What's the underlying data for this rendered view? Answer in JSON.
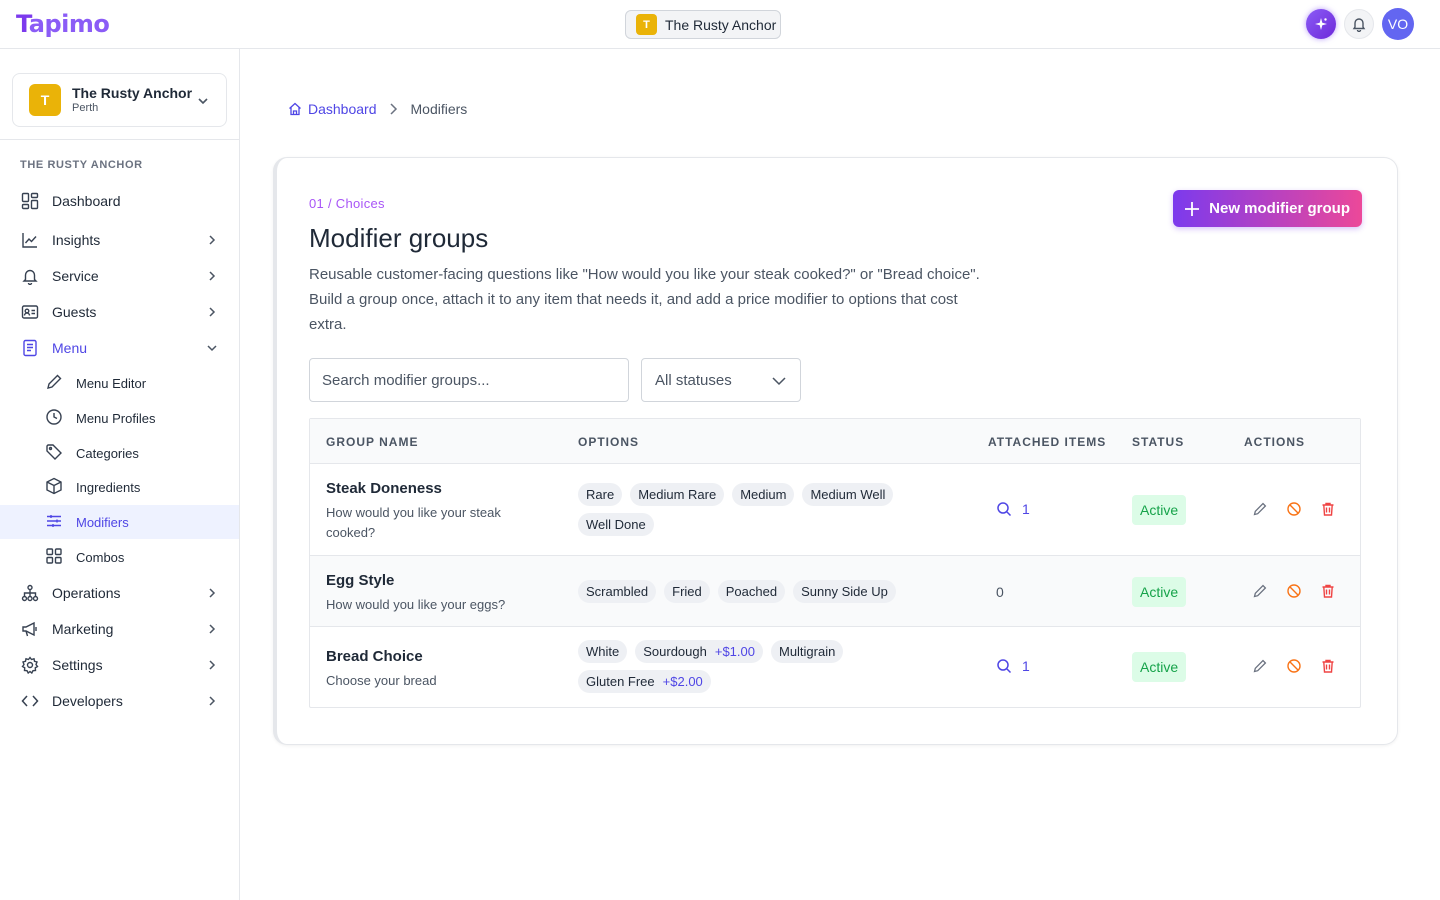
{
  "app": {
    "logo_first": "T",
    "logo_rest": "apimo",
    "venue_pill": {
      "badge": "T",
      "name": "The Rusty Anchor"
    },
    "avatar": "VO",
    "colors": {
      "accent": "#4f46e5",
      "brand": "#8b5cf6",
      "venue_badge": "#eab308",
      "active_green": "#16a34a"
    }
  },
  "sidebar": {
    "venue": {
      "badge": "T",
      "name": "The Rusty Anchor",
      "city": "Perth"
    },
    "section_label": "THE RUSTY ANCHOR",
    "items": [
      {
        "label": "Dashboard",
        "icon": "dashboard-icon"
      },
      {
        "label": "Insights",
        "icon": "chart-icon"
      },
      {
        "label": "Service",
        "icon": "bell-icon"
      },
      {
        "label": "Guests",
        "icon": "id-card-icon"
      },
      {
        "label": "Menu",
        "icon": "menu-book-icon"
      },
      {
        "label": "Operations",
        "icon": "network-icon"
      },
      {
        "label": "Marketing",
        "icon": "megaphone-icon"
      },
      {
        "label": "Settings",
        "icon": "gear-icon"
      },
      {
        "label": "Developers",
        "icon": "code-icon"
      }
    ],
    "menu_sub": [
      {
        "label": "Menu Editor",
        "icon": "pencil-icon"
      },
      {
        "label": "Menu Profiles",
        "icon": "clock-icon"
      },
      {
        "label": "Categories",
        "icon": "tag-icon"
      },
      {
        "label": "Ingredients",
        "icon": "cube-icon"
      },
      {
        "label": "Modifiers",
        "icon": "sliders-icon"
      },
      {
        "label": "Combos",
        "icon": "grid-icon"
      }
    ]
  },
  "breadcrumb": {
    "home": "Dashboard",
    "current": "Modifiers"
  },
  "page": {
    "eyebrow": "01 / Choices",
    "title": "Modifier groups",
    "description": "Reusable customer-facing questions like \"How would you like your steak cooked?\" or \"Bread choice\". Build a group once, attach it to any item that needs it, and add a price modifier to options that cost extra.",
    "new_button": "New modifier group"
  },
  "filters": {
    "search_placeholder": "Search modifier groups...",
    "status_value": "All statuses"
  },
  "table": {
    "headers": [
      "GROUP NAME",
      "OPTIONS",
      "ATTACHED ITEMS",
      "STATUS",
      "ACTIONS"
    ],
    "rows": [
      {
        "name": "Steak Doneness",
        "description": "How would you like your steak cooked?",
        "options": [
          {
            "label": "Rare"
          },
          {
            "label": "Medium Rare"
          },
          {
            "label": "Medium"
          },
          {
            "label": "Medium Well"
          },
          {
            "label": "Well Done"
          }
        ],
        "attached": "1",
        "status": "Active"
      },
      {
        "name": "Egg Style",
        "description": "How would you like your eggs?",
        "options": [
          {
            "label": "Scrambled"
          },
          {
            "label": "Fried"
          },
          {
            "label": "Poached"
          },
          {
            "label": "Sunny Side Up"
          }
        ],
        "attached": "0",
        "status": "Active"
      },
      {
        "name": "Bread Choice",
        "description": "Choose your bread",
        "options": [
          {
            "label": "White"
          },
          {
            "label": "Sourdough",
            "price": "+$1.00"
          },
          {
            "label": "Multigrain"
          },
          {
            "label": "Gluten Free",
            "price": "+$2.00"
          }
        ],
        "attached": "1",
        "status": "Active"
      }
    ]
  }
}
